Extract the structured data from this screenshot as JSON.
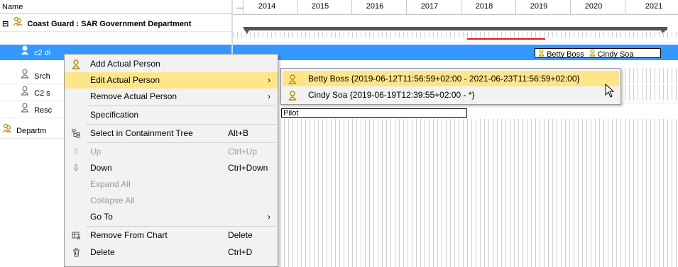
{
  "tree": {
    "header": "Name",
    "rows": [
      {
        "icon": "group-icon",
        "expander": "⊟",
        "label": "Coast Guard : SAR Government Department",
        "bold": true
      },
      {
        "icon": "person-icon",
        "label": "c2 di",
        "selected": true
      },
      {
        "icon": "person-icon",
        "label": "Srch"
      },
      {
        "icon": "person-icon",
        "label": "C2 s"
      },
      {
        "icon": "person-icon",
        "label": "Resc"
      },
      {
        "icon": "group-icon",
        "label": "Departm"
      }
    ]
  },
  "timeline": {
    "ellipsis": "...",
    "years": [
      "2014",
      "2015",
      "2016",
      "2017",
      "2018",
      "2019",
      "2020",
      "2021"
    ],
    "lifeline_tag": {
      "items": [
        "Betty Boss",
        "Cindy Soa"
      ]
    },
    "pilot_tag": "Pilot"
  },
  "context_menu": {
    "items": [
      {
        "icon": "person-icon",
        "label": "Add Actual Person",
        "shortcut": "",
        "submenu": false
      },
      {
        "icon": "",
        "label": "Edit Actual Person",
        "shortcut": "",
        "submenu": true,
        "highlighted": true
      },
      {
        "icon": "",
        "label": "Remove Actual Person",
        "shortcut": "",
        "submenu": true
      },
      {
        "icon": "",
        "label": "Specification",
        "shortcut": "",
        "submenu": false
      },
      {
        "icon": "tree-icon",
        "label": "Select in Containment Tree",
        "shortcut": "Alt+B",
        "submenu": false
      },
      {
        "icon": "arrow-up-icon",
        "label": "Up",
        "shortcut": "Ctrl+Up",
        "disabled": true
      },
      {
        "icon": "arrow-down-icon",
        "label": "Down",
        "shortcut": "Ctrl+Down"
      },
      {
        "icon": "",
        "label": "Expand All",
        "shortcut": "",
        "disabled": true
      },
      {
        "icon": "",
        "label": "Collapse All",
        "shortcut": "",
        "disabled": true
      },
      {
        "icon": "",
        "label": "Go To",
        "shortcut": "",
        "submenu": true
      },
      {
        "icon": "remove-chart-icon",
        "label": "Remove From Chart",
        "shortcut": "Delete"
      },
      {
        "icon": "trash-icon",
        "label": "Delete",
        "shortcut": "Ctrl+D"
      }
    ]
  },
  "submenu": {
    "items": [
      {
        "icon": "person-icon",
        "label": "Betty Boss {2019-06-12T11:56:59+02:00 - 2021-06-23T11:56:59+02:00}",
        "highlighted": true
      },
      {
        "icon": "person-icon",
        "label": "Cindy Soa {2019-06-19T12:39:55+02:00 - *}"
      }
    ]
  },
  "colors": {
    "selection": "#3399ff",
    "menu_highlight": "#ffe58a",
    "lifeline_red": "#e01818"
  }
}
